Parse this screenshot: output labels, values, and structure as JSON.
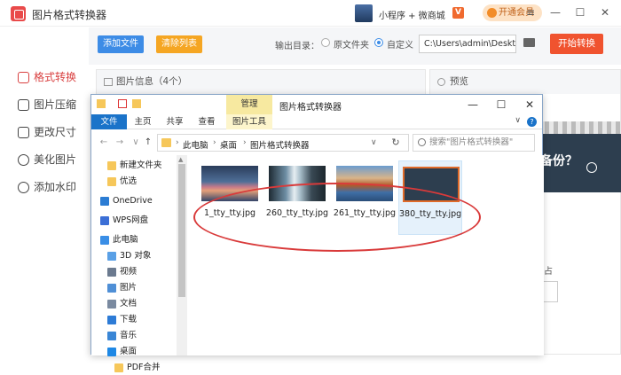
{
  "app": {
    "title": "图片格式转换器",
    "mini_link": "小程序 + 微商城",
    "v_badge": "V",
    "vip_label": "开通会员",
    "win_controls": [
      "≡",
      "—",
      "☐",
      "✕"
    ]
  },
  "sidebar": {
    "items": [
      {
        "label": "格式转换",
        "icon": "convert-icon",
        "active": true
      },
      {
        "label": "图片压缩",
        "icon": "compress-icon",
        "active": false
      },
      {
        "label": "更改尺寸",
        "icon": "resize-icon",
        "active": false
      },
      {
        "label": "美化图片",
        "icon": "beautify-icon",
        "active": false
      },
      {
        "label": "添加水印",
        "icon": "watermark-icon",
        "active": false
      }
    ]
  },
  "toolbar": {
    "add_label": "添加文件",
    "clear_label": "清除列表",
    "output_label": "输出目录：",
    "radio_source": "原文件夹",
    "radio_custom": "自定义",
    "path_value": "C:\\Users\\admin\\Deskto",
    "start_label": "开始转换"
  },
  "info_panel": {
    "title": "图片信息（4个）"
  },
  "preview_panel": {
    "title": "预览",
    "preview_text": "备份？",
    "side_label": "占"
  },
  "explorer": {
    "manage_tab": "管理",
    "window_title": "图片格式转换器",
    "ribbon_tabs": [
      "文件",
      "主页",
      "共享",
      "查看",
      "图片工具"
    ],
    "breadcrumb": [
      "此电脑",
      "桌面",
      "图片格式转换器"
    ],
    "search_placeholder": "搜索\"图片格式转换器\"",
    "nav_items": [
      {
        "label": "新建文件夹",
        "icon": "folder-icon",
        "color": "#f6c75a",
        "indent": 1
      },
      {
        "label": "优选",
        "icon": "folder-icon",
        "color": "#f6c75a",
        "indent": 1
      },
      {
        "label": "OneDrive",
        "icon": "onedrive-icon",
        "color": "#2b7cd3",
        "indent": 0
      },
      {
        "label": "WPS网盘",
        "icon": "wps-cloud-icon",
        "color": "#3b6fd6",
        "indent": 0
      },
      {
        "label": "此电脑",
        "icon": "pc-icon",
        "color": "#3a8ee6",
        "indent": 0
      },
      {
        "label": "3D 对象",
        "icon": "3d-objects-icon",
        "color": "#5aa0e6",
        "indent": 1
      },
      {
        "label": "视频",
        "icon": "video-icon",
        "color": "#6b7a8f",
        "indent": 1
      },
      {
        "label": "图片",
        "icon": "pictures-icon",
        "color": "#4f8fd6",
        "indent": 1
      },
      {
        "label": "文档",
        "icon": "documents-icon",
        "color": "#7a8aa0",
        "indent": 1
      },
      {
        "label": "下载",
        "icon": "download-icon",
        "color": "#2d7bd6",
        "indent": 1
      },
      {
        "label": "音乐",
        "icon": "music-icon",
        "color": "#3a86d6",
        "indent": 1
      },
      {
        "label": "桌面",
        "icon": "desktop-icon",
        "color": "#1e88e5",
        "indent": 1
      },
      {
        "label": "PDF合并",
        "icon": "folder-icon",
        "color": "#f6c75a",
        "indent": 2
      }
    ],
    "files": [
      {
        "name": "1_tty_tty.jpg",
        "selected": false
      },
      {
        "name": "260_tty_tty.jpg",
        "selected": false
      },
      {
        "name": "261_tty_tty.jpg",
        "selected": false
      },
      {
        "name": "380_tty_tty.jpg",
        "selected": true
      }
    ]
  },
  "colors": {
    "accent_red": "#d94040",
    "blue": "#3d8ce6",
    "orange": "#f5a623",
    "start_red": "#f0532f",
    "annotation": "#d93a3a"
  }
}
